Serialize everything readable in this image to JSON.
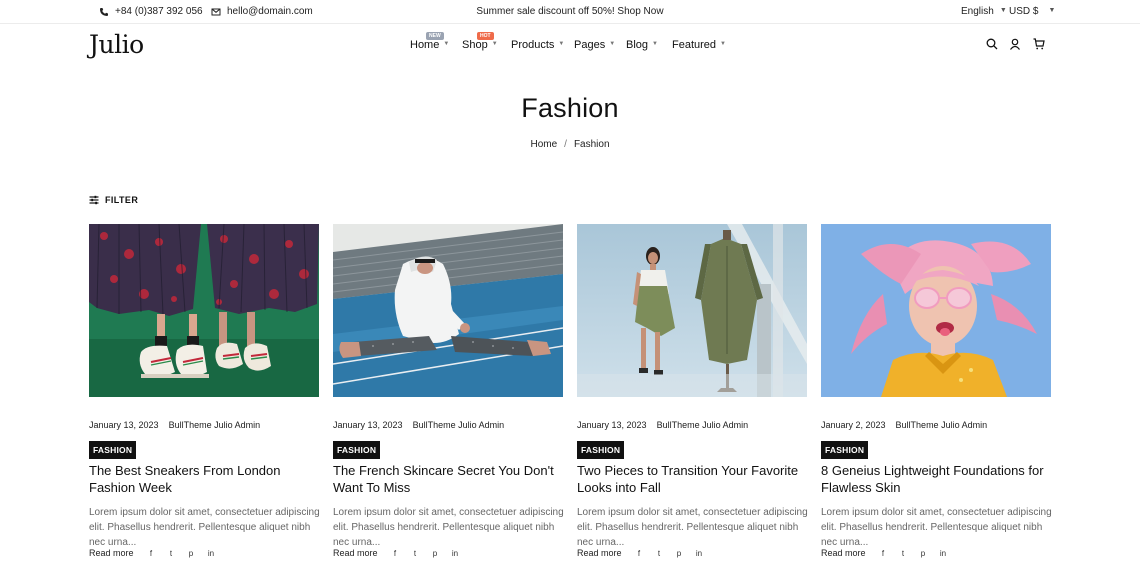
{
  "topbar": {
    "phone": "+84 (0)387 392 056",
    "email": "hello@domain.com",
    "promo": "Summer sale discount off 50%! Shop Now",
    "language": "English",
    "currency": "USD $"
  },
  "header": {
    "logo": "Julio",
    "nav": [
      {
        "label": "Home",
        "badge": "NEW",
        "badge_color": "#9aa3b2"
      },
      {
        "label": "Shop",
        "badge": "HOT",
        "badge_color": "#ef6b4a"
      },
      {
        "label": "Products"
      },
      {
        "label": "Pages"
      },
      {
        "label": "Blog"
      },
      {
        "label": "Featured"
      }
    ],
    "icons": [
      "search-icon",
      "account-icon",
      "cart-icon"
    ]
  },
  "page": {
    "title": "Fashion",
    "breadcrumb": {
      "home": "Home",
      "separator": "/",
      "current": "Fashion"
    },
    "filter_label": "FILTER"
  },
  "posts": [
    {
      "date": "January 13, 2023",
      "author": "BullTheme Julio Admin",
      "category": "FASHION",
      "title": "The Best Sneakers From London Fashion Week",
      "excerpt": "Lorem ipsum dolor sit amet, consectetuer adipiscing elit. Phasellus hendrerit. Pellentesque aliquet nibh nec urna...",
      "read_more": "Read more"
    },
    {
      "date": "January 13, 2023",
      "author": "BullTheme Julio Admin",
      "category": "FASHION",
      "title": "The French Skincare Secret You Don't Want To Miss",
      "excerpt": "Lorem ipsum dolor sit amet, consectetuer adipiscing elit. Phasellus hendrerit. Pellentesque aliquet nibh nec urna...",
      "read_more": "Read more"
    },
    {
      "date": "January 13, 2023",
      "author": "BullTheme Julio Admin",
      "category": "FASHION",
      "title": "Two Pieces to Transition Your Favorite Looks into Fall",
      "excerpt": "Lorem ipsum dolor sit amet, consectetuer adipiscing elit. Phasellus hendrerit. Pellentesque aliquet nibh nec urna...",
      "read_more": "Read more"
    },
    {
      "date": "January 2, 2023",
      "author": "BullTheme Julio Admin",
      "category": "FASHION",
      "title": "8 Geneius Lightweight Foundations for Flawless Skin",
      "excerpt": "Lorem ipsum dolor sit amet, consectetuer adipiscing elit. Phasellus hendrerit. Pellentesque aliquet nibh nec urna...",
      "read_more": "Read more"
    }
  ],
  "share": {
    "facebook": "f",
    "twitter": "t",
    "pinterest": "p",
    "linkedin": "in"
  }
}
